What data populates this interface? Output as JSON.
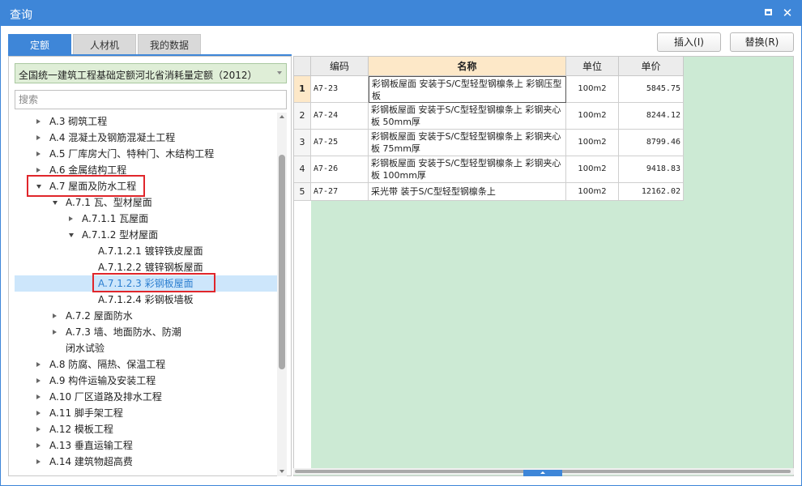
{
  "window": {
    "title": "查询"
  },
  "tabs": [
    {
      "label": "定额",
      "active": true
    },
    {
      "label": "人材机",
      "active": false
    },
    {
      "label": "我的数据",
      "active": false
    }
  ],
  "toolbar": {
    "insert_label": "插入(I)",
    "replace_label": "替换(R)"
  },
  "library_select": {
    "value": "全国统一建筑工程基础定额河北省消耗量定额（2012）"
  },
  "search": {
    "placeholder": "搜索",
    "value": ""
  },
  "tree": [
    {
      "label": "A.3 砌筑工程",
      "level": 0,
      "state": "collapsed"
    },
    {
      "label": "A.4 混凝土及钢筋混凝土工程",
      "level": 0,
      "state": "collapsed"
    },
    {
      "label": "A.5 厂库房大门、特种门、木结构工程",
      "level": 0,
      "state": "collapsed"
    },
    {
      "label": "A.6 金属结构工程",
      "level": 0,
      "state": "collapsed"
    },
    {
      "label": "A.7 屋面及防水工程",
      "level": 0,
      "state": "expanded"
    },
    {
      "label": "A.7.1 瓦、型材屋面",
      "level": 1,
      "state": "expanded"
    },
    {
      "label": "A.7.1.1 瓦屋面",
      "level": 2,
      "state": "collapsed"
    },
    {
      "label": "A.7.1.2 型材屋面",
      "level": 2,
      "state": "expanded"
    },
    {
      "label": "A.7.1.2.1 镀锌铁皮屋面",
      "level": 3,
      "state": "leaf"
    },
    {
      "label": "A.7.1.2.2 镀锌钢板屋面",
      "level": 3,
      "state": "leaf"
    },
    {
      "label": "A.7.1.2.3 彩钢板屋面",
      "level": 3,
      "state": "leaf",
      "selected": true
    },
    {
      "label": "A.7.1.2.4 彩钢板墙板",
      "level": 3,
      "state": "leaf"
    },
    {
      "label": "A.7.2 屋面防水",
      "level": 1,
      "state": "collapsed"
    },
    {
      "label": "A.7.3 墙、地面防水、防潮",
      "level": 1,
      "state": "collapsed"
    },
    {
      "label": "闭水试验",
      "level": 1,
      "state": "leaf"
    },
    {
      "label": "A.8 防腐、隔热、保温工程",
      "level": 0,
      "state": "collapsed"
    },
    {
      "label": "A.9 构件运输及安装工程",
      "level": 0,
      "state": "collapsed"
    },
    {
      "label": "A.10 厂区道路及排水工程",
      "level": 0,
      "state": "collapsed"
    },
    {
      "label": "A.11 脚手架工程",
      "level": 0,
      "state": "collapsed"
    },
    {
      "label": "A.12 模板工程",
      "level": 0,
      "state": "collapsed"
    },
    {
      "label": "A.13 垂直运输工程",
      "level": 0,
      "state": "collapsed"
    },
    {
      "label": "A.14 建筑物超高费",
      "level": 0,
      "state": "collapsed"
    }
  ],
  "grid": {
    "headers": {
      "code": "编码",
      "name": "名称",
      "unit": "单位",
      "price": "单价"
    },
    "rows": [
      {
        "num": "1",
        "code": "A7-23",
        "name": "彩钢板屋面 安装于S/C型轻型钢檩条上 彩钢压型板",
        "unit": "100m2",
        "price": "5845.75"
      },
      {
        "num": "2",
        "code": "A7-24",
        "name": "彩钢板屋面 安装于S/C型轻型钢檩条上 彩钢夹心板 50mm厚",
        "unit": "100m2",
        "price": "8244.12"
      },
      {
        "num": "3",
        "code": "A7-25",
        "name": "彩钢板屋面 安装于S/C型轻型钢檩条上 彩钢夹心板 75mm厚",
        "unit": "100m2",
        "price": "8799.46"
      },
      {
        "num": "4",
        "code": "A7-26",
        "name": "彩钢板屋面 安装于S/C型轻型钢檩条上 彩钢夹心板 100mm厚",
        "unit": "100m2",
        "price": "9418.83"
      },
      {
        "num": "5",
        "code": "A7-27",
        "name": "采光带 装于S/C型轻型钢檩条上",
        "unit": "100m2",
        "price": "12162.02"
      }
    ]
  },
  "colors": {
    "accent": "#3e86d8",
    "grid_background": "#ccead4",
    "highlight_box": "#e0262b",
    "selected_row": "#cde6fb"
  }
}
